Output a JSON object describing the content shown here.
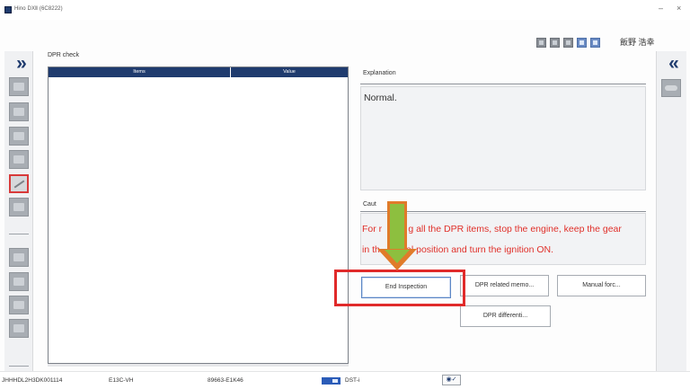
{
  "window": {
    "title": "Hino DXⅡ (6C8222)",
    "minimize_glyph": "–",
    "close_glyph": "×"
  },
  "header": {
    "user": "飯野 浩幸",
    "toolbar_icons": [
      "screen-icon",
      "print-icon",
      "settings-icon",
      "search-icon",
      "info-icon"
    ]
  },
  "sidebar": {
    "collapse_glyph": "»",
    "expand_glyph": "«",
    "icons": [
      "home-icon",
      "engine-icon",
      "vehicle-icon",
      "ecu-icon",
      "utility-icon",
      "tool-icon",
      "trip-icon",
      "monitor-icon",
      "report-icon",
      "lock-icon",
      "record-icon"
    ]
  },
  "dpr": {
    "title": "DPR check",
    "columns": [
      "Items",
      "Value"
    ],
    "rows": []
  },
  "explanation": {
    "label": "Explanation",
    "text": "Normal."
  },
  "caution": {
    "label": "Caut",
    "line1": "For r          g all the DPR items, stop the engine, keep the gear",
    "line2": "in th          al position and turn the ignition ON."
  },
  "buttons": {
    "end_inspection": "End Inspection",
    "dpr_memo": "DPR related memo...",
    "manual_force": "Manual forc...",
    "dpr_diff": "DPR differenti..."
  },
  "status": {
    "vin": "JHHHDL2H3DK001114",
    "engine": "E13C-VH",
    "part": "89663-E1K46",
    "tool": "DST-i",
    "conn_glyph": "◉✓"
  },
  "colors": {
    "accent": "#1f3b6e",
    "caution": "#e0302a",
    "highlight": "#e02a2a",
    "arrow_fill": "#8dbf3f",
    "arrow_border": "#e07b2a"
  }
}
